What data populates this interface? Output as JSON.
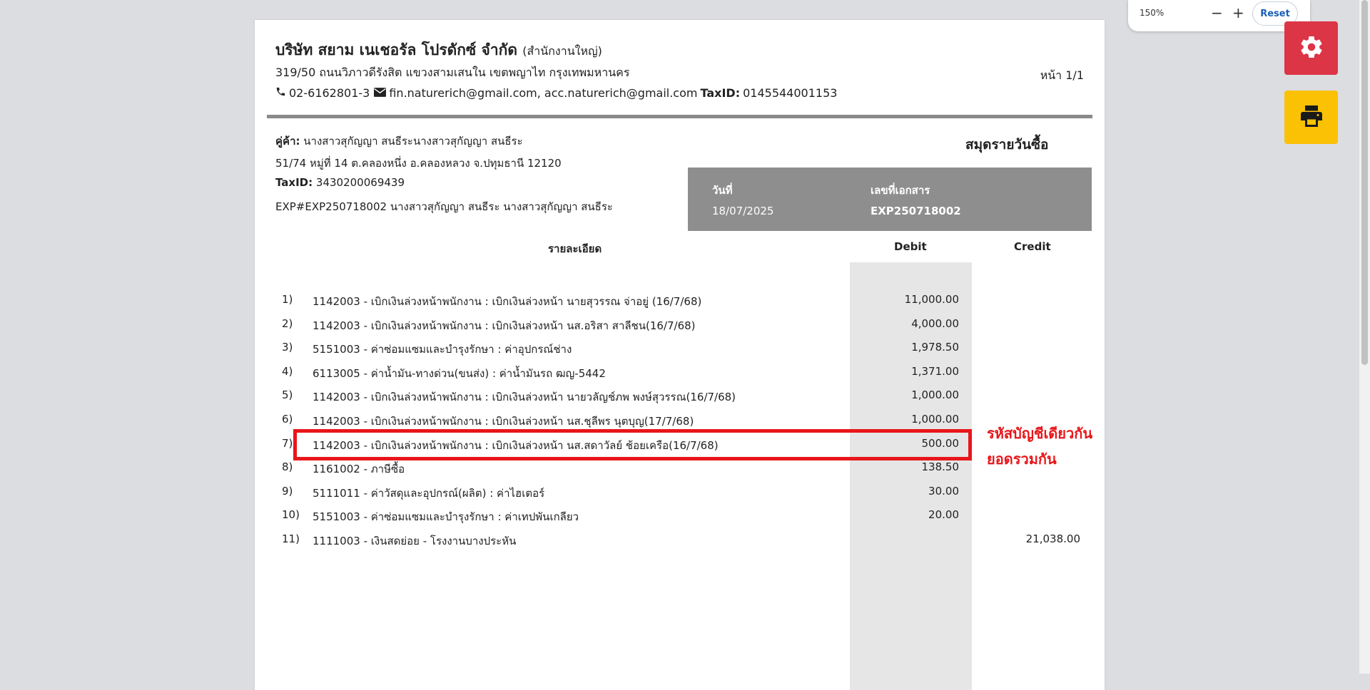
{
  "company": {
    "name": "บริษัท สยาม เนเชอรัล โปรดักซ์ จำกัด",
    "branch": "(สำนักงานใหญ่)",
    "address": "319/50 ถนนวิภาวดีรังสิต แขวงสามเสนใน เขตพญาไท กรุงเทพมหานคร",
    "phone": "02-6162801-3",
    "emails": "fin.naturerich@gmail.com, acc.naturerich@gmail.com",
    "taxid_label": "TaxID:",
    "taxid": "0145544001153"
  },
  "page_number": "หน้า 1/1",
  "party": {
    "label": "คู่ค้า:",
    "name": "นางสาวสุกัญญา สนธีระนางสาวสุกัญญา สนธีระ",
    "address": "51/74 หมู่ที่ 14 ต.คลองหนึ่ง อ.คลองหลวง จ.ปทุมธานี 12120",
    "taxid_label": "TaxID:",
    "taxid": "3430200069439",
    "ref": "EXP#EXP250718002 นางสาวสุกัญญา สนธีระ นางสาวสุกัญญา สนธีระ"
  },
  "document": {
    "title": "สมุดรายวันซื้อ",
    "date_label": "วันที่",
    "date": "18/07/2025",
    "docno_label": "เลขที่เอกสาร",
    "docno": "EXP250718002"
  },
  "table": {
    "headers": {
      "detail": "รายละเอียด",
      "debit": "Debit",
      "credit": "Credit"
    },
    "rows": [
      {
        "num": "1)",
        "desc": "1142003 - เบิกเงินล่วงหน้าพนักงาน : เบิกเงินล่วงหน้า นายสุวรรณ จ่าอยู่ (16/7/68)",
        "debit": "11,000.00",
        "credit": ""
      },
      {
        "num": "2)",
        "desc": "1142003 - เบิกเงินล่วงหน้าพนักงาน : เบิกเงินล่วงหน้า นส.อริสา สาลีชน(16/7/68)",
        "debit": "4,000.00",
        "credit": ""
      },
      {
        "num": "3)",
        "desc": "5151003 - ค่าซ่อมแซมและบำรุงรักษา : ค่าอุปกรณ์ช่าง",
        "debit": "1,978.50",
        "credit": ""
      },
      {
        "num": "4)",
        "desc": "6113005 - ค่าน้ำมัน-ทางด่วน(ขนส่ง) : ค่าน้ำมันรถ ฒญ-5442",
        "debit": "1,371.00",
        "credit": ""
      },
      {
        "num": "5)",
        "desc": "1142003 - เบิกเงินล่วงหน้าพนักงาน : เบิกเงินล่วงหน้า นายวลัญช์ภพ พงษ์สุวรรณ(16/7/68)",
        "debit": "1,000.00",
        "credit": ""
      },
      {
        "num": "6)",
        "desc": "1142003 - เบิกเงินล่วงหน้าพนักงาน : เบิกเงินล่วงหน้า นส.ชุลีพร นุตบุญ(17/7/68)",
        "debit": "1,000.00",
        "credit": ""
      },
      {
        "num": "7)",
        "desc": "1142003 - เบิกเงินล่วงหน้าพนักงาน : เบิกเงินล่วงหน้า นส.สดาวัลย์ ช้อยเครือ(16/7/68)",
        "debit": "500.00",
        "credit": ""
      },
      {
        "num": "8)",
        "desc": "1161002 - ภาษีซื้อ",
        "debit": "138.50",
        "credit": ""
      },
      {
        "num": "9)",
        "desc": "5111011 - ค่าวัสดุและอุปกรณ์(ผลิต) : ค่าไฮเตอร์",
        "debit": "30.00",
        "credit": ""
      },
      {
        "num": "10)",
        "desc": "5151003 - ค่าซ่อมแซมและบำรุงรักษา : ค่าเทปพันเกลียว",
        "debit": "20.00",
        "credit": ""
      },
      {
        "num": "11)",
        "desc": "1111003 - เงินสดย่อย - โรงงานบางประหัน",
        "debit": "",
        "credit": "21,038.00"
      }
    ]
  },
  "annotation": {
    "line1": "รหัสบัญชีเดียวกัน",
    "line2": "ยอดรวมกัน",
    "color": "#e8161a"
  },
  "zoom": {
    "level": "150%",
    "minus": "−",
    "plus": "+",
    "reset_label": "Reset"
  },
  "colors": {
    "settings_button": "#dc3545",
    "print_button": "#fbc105",
    "header_box": "#8e8e8e",
    "debit_band": "#e5e6e5"
  },
  "icons": {
    "phone": "phone-icon",
    "email": "envelope-icon",
    "settings": "gear-icon",
    "print": "printer-icon"
  }
}
